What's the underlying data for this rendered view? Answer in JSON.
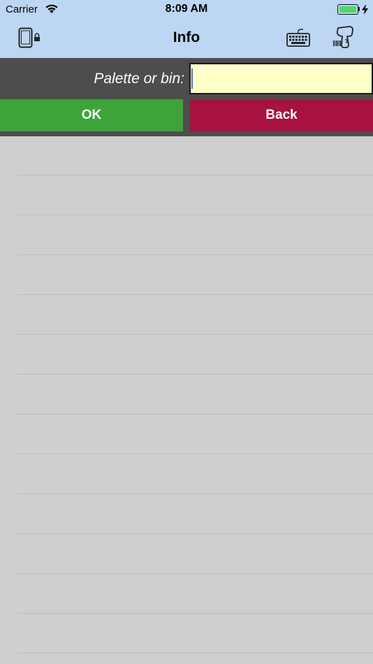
{
  "status_bar": {
    "carrier": "Carrier",
    "time": "8:09 AM",
    "battery_color": "#4cd964"
  },
  "nav": {
    "title": "Info",
    "left_icon": "device-lock-icon",
    "right_icons": [
      "keyboard-icon",
      "barcode-scanner-icon"
    ],
    "background": "#bcd6f3"
  },
  "form": {
    "label": "Palette or bin:",
    "input_value": "",
    "input_background": "#ffffc8",
    "ok_label": "OK",
    "back_label": "Back",
    "ok_color": "#3ea43a",
    "back_color": "#a8123f"
  },
  "list": {
    "rows": 13
  }
}
